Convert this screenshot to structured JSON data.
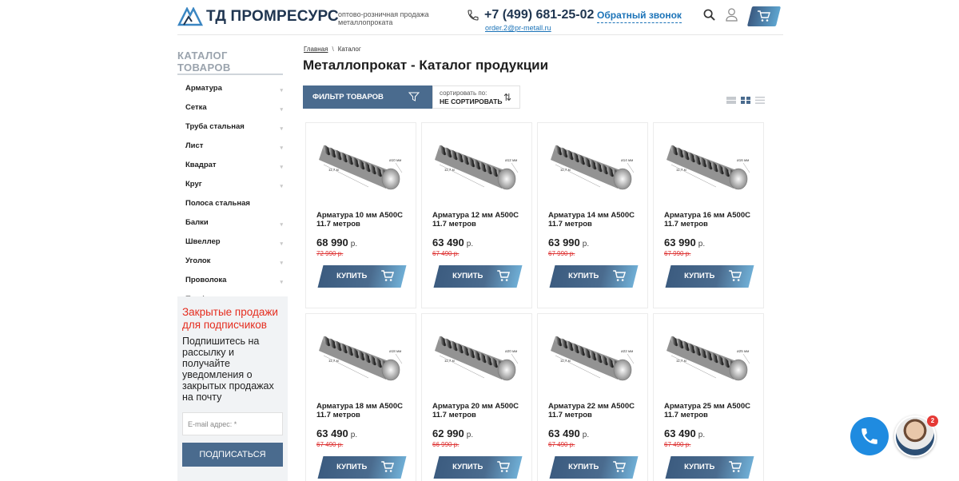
{
  "header": {
    "logo_text": "ТД ПРОМРЕСУРС",
    "tagline": "оптово-розничная продажа металлопроката",
    "phone": "+7 (499) 681-25-02",
    "callback_label": "Обратный звонок",
    "email": "order.2@pr-metall.ru",
    "icons": [
      "logo-icon",
      "phone-icon",
      "search-icon",
      "user-icon",
      "cart-icon"
    ]
  },
  "sidebar": {
    "title": "КАТАЛОГ ТОВАРОВ",
    "items": [
      {
        "label": "Арматура",
        "has_children": true
      },
      {
        "label": "Сетка",
        "has_children": true
      },
      {
        "label": "Труба стальная",
        "has_children": true
      },
      {
        "label": "Лист",
        "has_children": true
      },
      {
        "label": "Квадрат",
        "has_children": true
      },
      {
        "label": "Круг",
        "has_children": true
      },
      {
        "label": "Полоса стальная",
        "has_children": false
      },
      {
        "label": "Балки",
        "has_children": true
      },
      {
        "label": "Швеллер",
        "has_children": true
      },
      {
        "label": "Уголок",
        "has_children": true
      },
      {
        "label": "Проволока",
        "has_children": true
      },
      {
        "label": "Профнастил",
        "has_children": true
      }
    ]
  },
  "subscribe": {
    "title": "Закрытые продажи для подписчиков",
    "text": "Подпишитесь на рассылку и получайте уведомления о закрытых продажах на почту",
    "input_placeholder": "E-mail адрес: *",
    "button_label": "ПОДПИСАТЬСЯ"
  },
  "breadcrumb": {
    "home": "Главная",
    "separator": "\\",
    "current": "Каталог"
  },
  "page_title": "Металлопрокат - Каталог продукции",
  "toolbar": {
    "filter_label": "ФИЛЬТР ТОВАРОВ",
    "sort_label": "сортировать по:",
    "sort_value": "НЕ СОРТИРОВАТЬ",
    "view_modes": [
      "list-wide",
      "grid",
      "list"
    ],
    "active_view": "grid"
  },
  "products": [
    {
      "name": "Арматура 10 мм А500С 11.7 метров",
      "price": "68 990",
      "currency": "р.",
      "old_price": "72 990 р.",
      "diameter": "ø10 мм",
      "length": "11,7 м",
      "buy_label": "КУПИТЬ"
    },
    {
      "name": "Арматура 12 мм А500С 11.7 метров",
      "price": "63 490",
      "currency": "р.",
      "old_price": "67 490 р.",
      "diameter": "ø12 мм",
      "length": "11,7 м",
      "buy_label": "КУПИТЬ"
    },
    {
      "name": "Арматура 14 мм А500С 11.7 метров",
      "price": "63 990",
      "currency": "р.",
      "old_price": "67 990 р.",
      "diameter": "ø14 мм",
      "length": "11,7 м",
      "buy_label": "КУПИТЬ"
    },
    {
      "name": "Арматура 16 мм А500С 11.7 метров",
      "price": "63 990",
      "currency": "р.",
      "old_price": "67 990 р.",
      "diameter": "ø16 мм",
      "length": "11,7 м",
      "buy_label": "КУПИТЬ"
    },
    {
      "name": "Арматура 18 мм А500С 11.7 метров",
      "price": "63 490",
      "currency": "р.",
      "old_price": "67 490 р.",
      "diameter": "ø18 мм",
      "length": "11,7 м",
      "buy_label": "КУПИТЬ"
    },
    {
      "name": "Арматура 20 мм А500С 11.7 метров",
      "price": "62 990",
      "currency": "р.",
      "old_price": "66 990 р.",
      "diameter": "ø20 мм",
      "length": "11,7 м",
      "buy_label": "КУПИТЬ"
    },
    {
      "name": "Арматура 22 мм А500С 11.7 метров",
      "price": "63 490",
      "currency": "р.",
      "old_price": "67 490 р.",
      "diameter": "ø22 мм",
      "length": "11,7 м",
      "buy_label": "КУПИТЬ"
    },
    {
      "name": "Арматура 25 мм А500С 11.7 метров",
      "price": "63 490",
      "currency": "р.",
      "old_price": "67 490 р.",
      "diameter": "ø25 мм",
      "length": "11,7 м",
      "buy_label": "КУПИТЬ"
    }
  ],
  "floating": {
    "chat_badge": "2"
  },
  "colors": {
    "accent": "#4a6b8e",
    "link": "#1b73b8",
    "promo": "#e52d1f",
    "old_price": "#dd3333",
    "call": "#1f8be0"
  }
}
